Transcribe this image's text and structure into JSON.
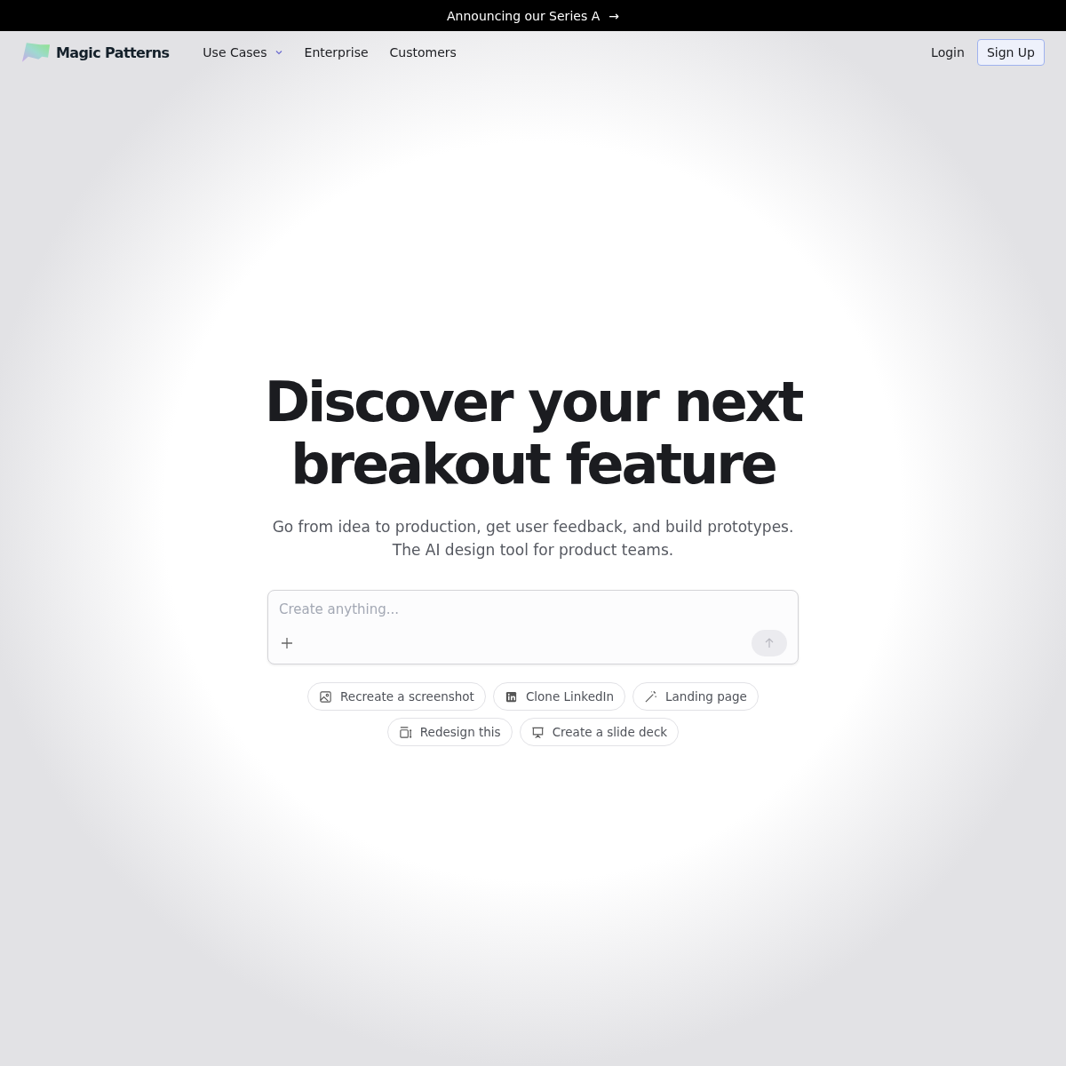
{
  "banner": {
    "text": "Announcing our Series A",
    "arrow": "→"
  },
  "nav": {
    "brand": "Magic Patterns",
    "links": [
      {
        "label": "Use Cases",
        "dropdown": true
      },
      {
        "label": "Enterprise",
        "dropdown": false
      },
      {
        "label": "Customers",
        "dropdown": false
      }
    ],
    "login": "Login",
    "signup": "Sign Up"
  },
  "hero": {
    "title_lines": [
      "Discover your next",
      "breakout feature"
    ],
    "subtitle_lines": [
      "Go from idea to production, get user feedback, and build prototypes.",
      "The AI design tool for product teams."
    ]
  },
  "prompt": {
    "placeholder": "Create anything..."
  },
  "suggestions": [
    [
      {
        "kind": "image",
        "label": "Recreate a screenshot"
      },
      {
        "kind": "linkedin",
        "label": "Clone LinkedIn"
      },
      {
        "kind": "wand",
        "label": "Landing page"
      }
    ],
    [
      {
        "kind": "resize",
        "label": "Redesign this"
      },
      {
        "kind": "slides",
        "label": "Create a slide deck"
      }
    ]
  ]
}
